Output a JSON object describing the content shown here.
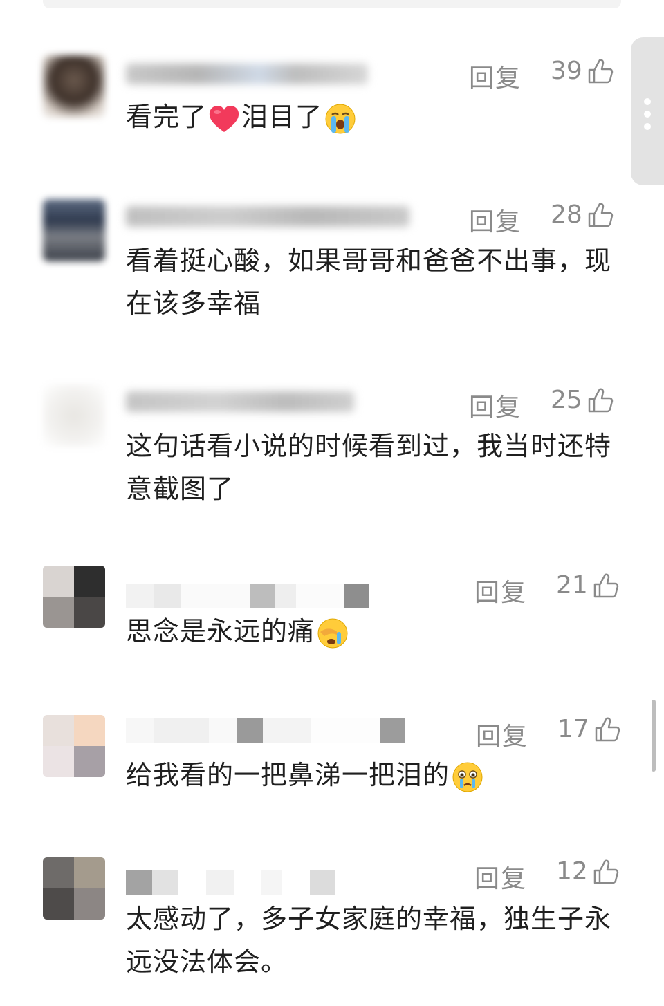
{
  "reply_label": "回复",
  "comments": [
    {
      "likes": "39",
      "text_before": "看完了",
      "text_mid": "泪目了",
      "text_after": ""
    },
    {
      "likes": "28",
      "text": "看着挺心酸，如果哥哥和爸爸不出事，现在该多幸福"
    },
    {
      "likes": "25",
      "text": "这句话看小说的时候看到过，我当时还特意截图了"
    },
    {
      "likes": "21",
      "text": "思念是永远的痛"
    },
    {
      "likes": "17",
      "text": "给我看的一把鼻涕一把泪的"
    },
    {
      "likes": "12",
      "text": "太感动了，多子女家庭的幸福，独生子永远没法体会。"
    }
  ],
  "icons": {
    "like": "thumbs-up-outline-icon",
    "heart": "red-heart-emoji",
    "crying": "loudly-crying-emoji",
    "facepalm": "crying-covering-face-emoji",
    "tearful": "tearful-face-emoji",
    "more": "vertical-ellipsis-icon"
  },
  "colors": {
    "meta_text": "#8a8a8a",
    "body_text": "#1f1f1f",
    "handle_bg": "#e3e3e3",
    "scrollbar": "#bdbdbd"
  }
}
